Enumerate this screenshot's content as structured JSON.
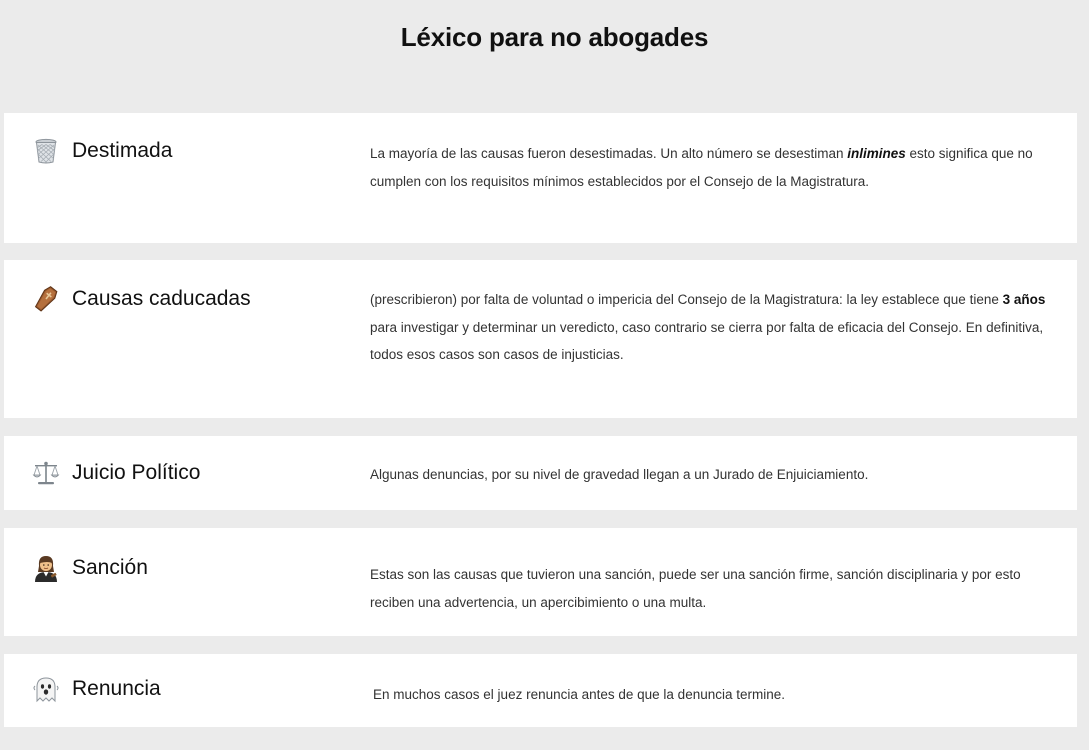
{
  "page": {
    "title": "Léxico para no abogades"
  },
  "terms": [
    {
      "label": "Destimada",
      "icon": "wastebasket-icon",
      "desc_before": "La mayoría de las causas fueron desestimadas.  Un alto número se desestiman ",
      "desc_emph": "inlimines",
      "desc_after": " esto significa que no cumplen con los requisitos mínimos establecidos por el Consejo de la Magistratura."
    },
    {
      "label": "Causas caducadas",
      "icon": "coffin-icon",
      "desc_before": "(prescribieron) por falta de voluntad o impericia del Consejo de la Magistratura: la ley establece que tiene ",
      "desc_emph": "3 años",
      "desc_after": " para investigar y determinar un veredicto, caso contrario se cierra por falta de eficacia del Consejo. En definitiva, todos esos casos son casos de injusticias."
    },
    {
      "label": "Juicio Político",
      "icon": "balance-scale-icon",
      "desc": "Algunas denuncias, por su nivel de gravedad llegan a un Jurado de Enjuiciamiento."
    },
    {
      "label": "Sanción",
      "icon": "judge-icon",
      "desc": "Estas son las causas que tuvieron una sanción, puede ser una sanción firme, sanción disciplinaria y por esto reciben una advertencia, un apercibimiento o una  multa."
    },
    {
      "label": "Renuncia",
      "icon": "ghost-icon",
      "desc": "En muchos casos el juez renuncia antes de que la denuncia termine."
    }
  ]
}
